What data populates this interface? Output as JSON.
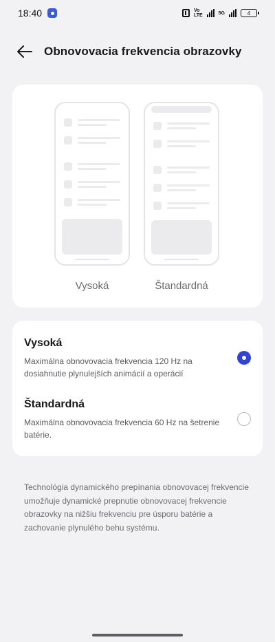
{
  "status_bar": {
    "time": "18:40",
    "network_top": "Vo",
    "network_bottom": "LTE",
    "network2_top": "5G",
    "battery_level": "4"
  },
  "header": {
    "title": "Obnovovacia frekvencia obrazovky"
  },
  "preview": {
    "left_caption": "Vysoká",
    "right_caption": "Štandardná"
  },
  "options": [
    {
      "title": "Vysoká",
      "description": "Maximálna obnovovacia frekvencia 120 Hz na dosiahnutie plynulejších animácií a operácií",
      "selected": true
    },
    {
      "title": "Štandardná",
      "description": "Maximálna obnovovacia frekvencia 60 Hz na šetrenie batérie.",
      "selected": false
    }
  ],
  "footer_note": "Technológia dynamického prepínania obnovovacej frekvencie umožňuje dynamické prepnutie obnovovacej frekvencie obrazovky na nižšiu frekvenciu pre úsporu batérie a zachovanie plynulého behu systému.",
  "colors": {
    "accent": "#2f44d6",
    "background": "#f2f2f4",
    "card": "#ffffff"
  }
}
